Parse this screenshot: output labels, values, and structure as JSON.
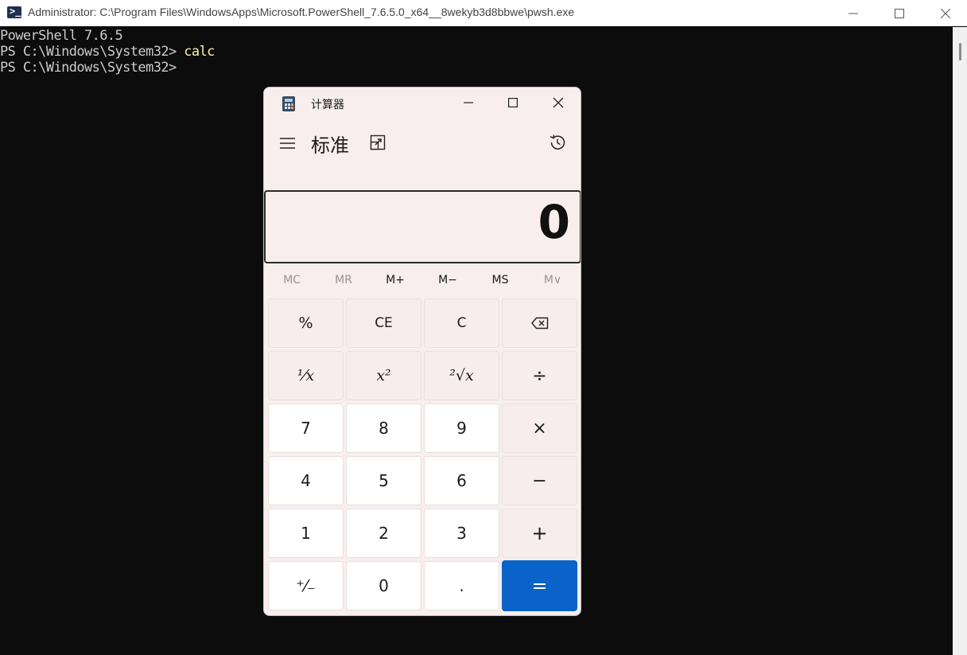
{
  "terminal": {
    "title": "Administrator: C:\\Program Files\\WindowsApps\\Microsoft.PowerShell_7.6.5.0_x64__8wekyb3d8bbwe\\pwsh.exe",
    "lines": [
      {
        "text": "PowerShell 7.6.5"
      },
      {
        "prompt": "PS C:\\Windows\\System32> ",
        "command": "calc"
      },
      {
        "prompt": "PS C:\\Windows\\System32> "
      }
    ]
  },
  "calculator": {
    "window_title": "计算器",
    "mode": "标准",
    "display": "0",
    "memory": [
      {
        "label": "MC",
        "enabled": false
      },
      {
        "label": "MR",
        "enabled": false
      },
      {
        "label": "M+",
        "enabled": true
      },
      {
        "label": "M−",
        "enabled": true
      },
      {
        "label": "MS",
        "enabled": true
      },
      {
        "label": "M∨",
        "enabled": false
      }
    ],
    "keys": {
      "percent": "%",
      "ce": "CE",
      "c": "C",
      "reciprocal": "¹⁄x",
      "square": "x²",
      "sqrt": "²√x",
      "divide": "÷",
      "seven": "7",
      "eight": "8",
      "nine": "9",
      "multiply": "×",
      "four": "4",
      "five": "5",
      "six": "6",
      "minus": "−",
      "one": "1",
      "two": "2",
      "three": "3",
      "plus": "+",
      "negate": "⁺⁄₋",
      "zero": "0",
      "decimal": ".",
      "equals": "="
    },
    "colors": {
      "equals_bg": "#0a63c9",
      "window_bg": "#f9eeee"
    }
  }
}
